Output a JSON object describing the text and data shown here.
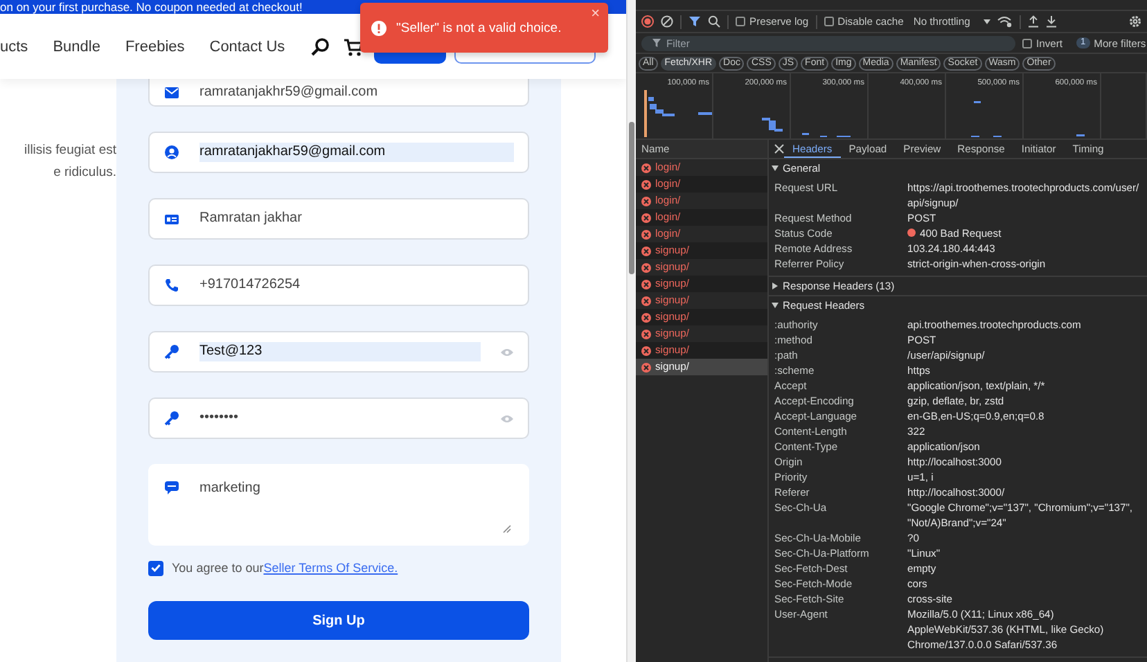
{
  "page": {
    "banner": "on on your first purchase. No coupon needed at checkout!",
    "nav": [
      "ucts",
      "Bundle",
      "Freebies",
      "Contact Us"
    ],
    "toast": {
      "message": "\"Seller\" is not a valid choice.",
      "close": "×"
    },
    "intro_lines": [
      "illisis feugiat est",
      "e ridiculus."
    ],
    "fields": [
      {
        "kind": "email",
        "value": "ramratanjakhr59@gmail.com",
        "text_selected": false
      },
      {
        "kind": "user",
        "value": "ramratanjakhar59@gmail.com",
        "text_selected": true
      },
      {
        "kind": "name",
        "value": "Ramratan jakhar",
        "text_selected": false
      },
      {
        "kind": "phone",
        "value": "+917014726254",
        "text_selected": false
      },
      {
        "kind": "password",
        "value": "Test@123",
        "text_selected": true
      },
      {
        "kind": "password",
        "value": "••••••••",
        "text_selected": false
      },
      {
        "kind": "textarea",
        "value": "marketing",
        "text_selected": false
      }
    ],
    "terms": {
      "checked": true,
      "text": "You agree to our",
      "link": "Seller Terms Of Service."
    },
    "submit": "Sign Up"
  },
  "devtools": {
    "toolbar": {
      "preserve_log": false,
      "preserve_log_label": "Preserve log",
      "disable_cache": false,
      "disable_cache_label": "Disable cache",
      "throttling": "No throttling"
    },
    "filter": {
      "placeholder": "Filter",
      "invert": false,
      "invert_label": "Invert",
      "more_filters_count": "1",
      "more_filters": "More filters"
    },
    "types": [
      {
        "label": "All",
        "selected": false
      },
      {
        "label": "Fetch/XHR",
        "selected": true
      },
      {
        "label": "Doc",
        "selected": false
      },
      {
        "label": "CSS",
        "selected": false
      },
      {
        "label": "JS",
        "selected": false
      },
      {
        "label": "Font",
        "selected": false
      },
      {
        "label": "Img",
        "selected": false
      },
      {
        "label": "Media",
        "selected": false
      },
      {
        "label": "Manifest",
        "selected": false
      },
      {
        "label": "Socket",
        "selected": false
      },
      {
        "label": "Wasm",
        "selected": false
      },
      {
        "label": "Other",
        "selected": false
      }
    ],
    "timeline_ticks": [
      "100,000 ms",
      "200,000 ms",
      "300,000 ms",
      "400,000 ms",
      "500,000 ms",
      "600,000 ms"
    ],
    "requests": {
      "header": "Name",
      "rows": [
        {
          "name": "login/",
          "selected": false
        },
        {
          "name": "login/",
          "selected": false
        },
        {
          "name": "login/",
          "selected": false
        },
        {
          "name": "login/",
          "selected": false
        },
        {
          "name": "login/",
          "selected": false
        },
        {
          "name": "signup/",
          "selected": false
        },
        {
          "name": "signup/",
          "selected": false
        },
        {
          "name": "signup/",
          "selected": false
        },
        {
          "name": "signup/",
          "selected": false
        },
        {
          "name": "signup/",
          "selected": false
        },
        {
          "name": "signup/",
          "selected": false
        },
        {
          "name": "signup/",
          "selected": false
        },
        {
          "name": "signup/",
          "selected": true
        }
      ]
    },
    "detail_tabs": [
      {
        "label": "Headers",
        "selected": true
      },
      {
        "label": "Payload",
        "selected": false
      },
      {
        "label": "Preview",
        "selected": false
      },
      {
        "label": "Response",
        "selected": false
      },
      {
        "label": "Initiator",
        "selected": false
      },
      {
        "label": "Timing",
        "selected": false
      }
    ],
    "sections": [
      {
        "title": "General",
        "expanded": true,
        "rows": [
          {
            "kind": "text",
            "key": "Request URL",
            "value": "https://api.troothemes.trootechproducts.com/user/api/signup/"
          },
          {
            "kind": "text",
            "key": "Request Method",
            "value": "POST"
          },
          {
            "kind": "status",
            "key": "Status Code",
            "value": "400 Bad Request"
          },
          {
            "kind": "text",
            "key": "Remote Address",
            "value": "103.24.180.44:443"
          },
          {
            "kind": "text",
            "key": "Referrer Policy",
            "value": "strict-origin-when-cross-origin"
          }
        ]
      },
      {
        "title": "Response Headers (13)",
        "expanded": false
      },
      {
        "title": "Request Headers",
        "expanded": true,
        "rows": [
          {
            "kind": "text",
            "key": ":authority",
            "value": "api.troothemes.trootechproducts.com"
          },
          {
            "kind": "text",
            "key": ":method",
            "value": "POST"
          },
          {
            "kind": "text",
            "key": ":path",
            "value": "/user/api/signup/"
          },
          {
            "kind": "text",
            "key": ":scheme",
            "value": "https"
          },
          {
            "kind": "text",
            "key": "Accept",
            "value": "application/json, text/plain, */*"
          },
          {
            "kind": "text",
            "key": "Accept-Encoding",
            "value": "gzip, deflate, br, zstd"
          },
          {
            "kind": "text",
            "key": "Accept-Language",
            "value": "en-GB,en-US;q=0.9,en;q=0.8"
          },
          {
            "kind": "text",
            "key": "Content-Length",
            "value": "322"
          },
          {
            "kind": "text",
            "key": "Content-Type",
            "value": "application/json"
          },
          {
            "kind": "text",
            "key": "Origin",
            "value": "http://localhost:3000"
          },
          {
            "kind": "text",
            "key": "Priority",
            "value": "u=1, i"
          },
          {
            "kind": "text",
            "key": "Referer",
            "value": "http://localhost:3000/"
          },
          {
            "kind": "text",
            "key": "Sec-Ch-Ua",
            "value": "\"Google Chrome\";v=\"137\", \"Chromium\";v=\"137\", \"Not/A)Brand\";v=\"24\""
          },
          {
            "kind": "text",
            "key": "Sec-Ch-Ua-Mobile",
            "value": "?0"
          },
          {
            "kind": "text",
            "key": "Sec-Ch-Ua-Platform",
            "value": "\"Linux\""
          },
          {
            "kind": "text",
            "key": "Sec-Fetch-Dest",
            "value": "empty"
          },
          {
            "kind": "text",
            "key": "Sec-Fetch-Mode",
            "value": "cors"
          },
          {
            "kind": "text",
            "key": "Sec-Fetch-Site",
            "value": "cross-site"
          },
          {
            "kind": "text",
            "key": "User-Agent",
            "value": "Mozilla/5.0 (X11; Linux x86_64) AppleWebKit/537.36 (KHTML, like Gecko) Chrome/137.0.0.0 Safari/537.36"
          }
        ]
      }
    ]
  }
}
